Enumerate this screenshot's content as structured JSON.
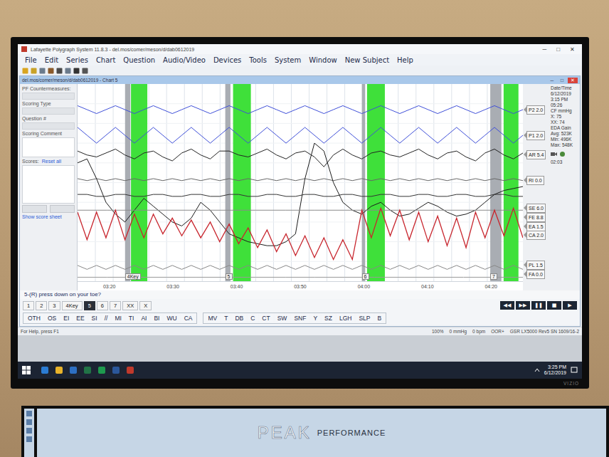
{
  "window": {
    "title": "Lafayette Polygraph System 11.8.3 - del.mos/comer/meson/d/dab0612019",
    "controls": [
      "─",
      "□",
      "✕"
    ]
  },
  "menu": [
    "File",
    "Edit",
    "Series",
    "Chart",
    "Question",
    "Audio/Video",
    "Devices",
    "Tools",
    "System",
    "Window",
    "New Subject",
    "Help"
  ],
  "inner_window": {
    "title": "del.mos/comer/meson/d/dab0612019 - Chart 5",
    "controls": [
      "─",
      "□",
      "✕"
    ]
  },
  "left_panel": {
    "countermeasures": "PF Countermeasures:",
    "scoring_type": "Scoring Type",
    "question": "Question #",
    "comment": "Scoring Comment",
    "scores": "Scores:",
    "reset": "Reset all",
    "show_sheet": "Show score sheet"
  },
  "info": [
    "Date/Time",
    "6/12/2019",
    "3:15 PM",
    "05:26",
    "CF mmHg",
    "X: 75",
    "XX: 74",
    "EDA Gain",
    "Avg: 523K",
    "Min: 496K",
    "Max: 548K"
  ],
  "timer": "02:03",
  "chart": {
    "channels": [
      {
        "name": "P2",
        "scale": "2.0",
        "color": "#3f4fd8",
        "values": [
          89,
          87,
          85,
          87,
          89,
          87,
          85,
          87,
          89,
          87,
          85,
          87,
          89,
          87,
          85,
          87,
          89,
          87,
          85,
          87,
          89,
          87,
          85,
          87,
          89,
          87,
          85,
          87,
          89,
          87,
          85,
          87,
          89,
          87,
          85,
          87,
          89,
          87,
          85,
          87,
          89,
          87,
          85,
          87,
          89,
          87,
          85,
          87
        ]
      },
      {
        "name": "P1",
        "scale": "2.0",
        "color": "#3f4fd8",
        "values": [
          78,
          74,
          70,
          74,
          78,
          74,
          70,
          74,
          78,
          74,
          70,
          74,
          78,
          74,
          70,
          74,
          78,
          74,
          70,
          74,
          78,
          74,
          70,
          74,
          78,
          74,
          70,
          74,
          78,
          74,
          70,
          74,
          78,
          74,
          70,
          74,
          78,
          74,
          70,
          74,
          78,
          74,
          70,
          74,
          78,
          74,
          70,
          74
        ]
      },
      {
        "name": "AR",
        "scale": "5.4",
        "color": "#222222",
        "values": [
          66,
          64,
          63,
          65,
          67,
          64,
          62,
          65,
          66,
          63,
          61,
          65,
          67,
          64,
          62,
          66,
          66,
          64,
          63,
          65,
          67,
          64,
          62,
          65,
          66,
          63,
          58,
          64,
          67,
          64,
          62,
          65,
          66,
          64,
          63,
          65,
          67,
          64,
          62,
          65,
          66,
          63,
          61,
          65,
          67,
          64,
          62,
          65
        ]
      },
      {
        "name": "RI",
        "scale": "0.0",
        "color": "#666666",
        "values": [
          52,
          51,
          52,
          51,
          52,
          51,
          52,
          51,
          52,
          51,
          52,
          51,
          52,
          51,
          52,
          51,
          52,
          51,
          52,
          51,
          52,
          51,
          52,
          51,
          52,
          51,
          52,
          51,
          52,
          51,
          52,
          51,
          52,
          51,
          52,
          51,
          52,
          51,
          52,
          51,
          52,
          51,
          52,
          51,
          52,
          51,
          52,
          51
        ]
      },
      {
        "name": "SE",
        "scale": "6.0",
        "color": "#1a1a1a",
        "values": [
          60,
          62,
          52,
          40,
          34,
          30,
          36,
          42,
          38,
          34,
          30,
          28,
          32,
          40,
          36,
          30,
          24,
          22,
          20,
          19,
          18,
          18,
          20,
          24,
          52,
          70,
          66,
          50,
          40,
          36,
          34,
          38,
          40,
          36,
          33,
          34,
          37,
          40,
          38,
          35,
          33,
          34,
          36,
          40,
          44,
          46,
          47,
          48
        ]
      },
      {
        "name": "FE",
        "scale": "8.8",
        "color": "#333333",
        "values": [
          44,
          44,
          43,
          43,
          44,
          44,
          43,
          43,
          44,
          44,
          43,
          43,
          44,
          44,
          43,
          43,
          44,
          44,
          43,
          43,
          44,
          44,
          43,
          43,
          44,
          44,
          43,
          43,
          44,
          44,
          43,
          43,
          44,
          44,
          43,
          43,
          44,
          44,
          43,
          43,
          44,
          44,
          43,
          43,
          44,
          44,
          43,
          43
        ]
      },
      {
        "name": "EA",
        "scale": "1.5",
        "color": "#8a8a8a",
        "values": [
          36,
          36,
          36,
          36,
          36,
          36,
          36,
          36,
          36,
          36,
          36,
          36,
          36,
          36,
          36,
          36
        ]
      },
      {
        "name": "CA",
        "scale": "2.0",
        "color": "#c8262e",
        "values": [
          35,
          21,
          35,
          22,
          36,
          21,
          34,
          22,
          34,
          24,
          32,
          23,
          31,
          22,
          30,
          20,
          29,
          19,
          27,
          17,
          26,
          15,
          24,
          13,
          23,
          12,
          22,
          11,
          21,
          11,
          36,
          22,
          37,
          23,
          36,
          21,
          35,
          20,
          33,
          18,
          32,
          17,
          35,
          22,
          36,
          23,
          37,
          22
        ]
      },
      {
        "name": "PL",
        "scale": "1.5",
        "color": "#888888",
        "values": [
          8,
          6,
          8,
          6,
          8,
          6,
          8,
          6,
          8,
          6,
          8,
          6,
          8,
          6,
          8,
          6,
          8,
          6,
          8,
          6,
          8,
          6,
          8,
          6,
          8,
          6,
          8,
          6,
          8,
          6,
          8,
          6,
          8,
          6,
          8,
          6,
          8,
          6,
          8,
          6,
          8,
          6,
          8,
          6,
          8,
          6,
          8,
          6
        ]
      },
      {
        "name": "FA",
        "scale": "0.0",
        "color": "#9a9a9a",
        "values": [
          2,
          2,
          2,
          2,
          2,
          2,
          2,
          2,
          2,
          2,
          2,
          2,
          2,
          2,
          2,
          2
        ]
      }
    ],
    "events": [
      {
        "label": "4Key",
        "mark": [
          12.8,
          14.2
        ],
        "answer": [
          14.4,
          18.8
        ]
      },
      {
        "label": "5",
        "mark": [
          39.8,
          41.2
        ],
        "answer": [
          41.9,
          46.7
        ]
      },
      {
        "label": "6",
        "mark": [
          76.6,
          77.5
        ],
        "answer": [
          78.0,
          82.8
        ]
      },
      {
        "label": "7",
        "mark": [
          111.2,
          114.2
        ],
        "answer": [
          114.8,
          118.8
        ]
      }
    ],
    "ticks": [
      "03:20",
      "03:30",
      "03:40",
      "03:50",
      "04:00",
      "04:10",
      "04:20"
    ]
  },
  "question": "5-(R) press down on your toe?",
  "series_tabs": [
    {
      "label": "1",
      "selected": false
    },
    {
      "label": "2",
      "selected": false
    },
    {
      "label": "3",
      "selected": false
    },
    {
      "label": "4Key",
      "selected": false
    },
    {
      "label": "5",
      "selected": true
    },
    {
      "label": "6",
      "selected": false
    },
    {
      "label": "7",
      "selected": false
    },
    {
      "label": "XX",
      "selected": false
    },
    {
      "label": "X",
      "selected": false
    }
  ],
  "playback": [
    "◀◀",
    "▶▶",
    "❚❚",
    "■",
    "▶"
  ],
  "score_buttons": [
    [
      "OTH",
      "OS",
      "EI",
      "EE",
      "SI",
      "//",
      "MI",
      "TI",
      "AI",
      "BI",
      "WU",
      "CA"
    ],
    [
      "MV",
      "T",
      "DB",
      "C",
      "CT",
      "SW",
      "SNF",
      "Y",
      "SZ",
      "LGH",
      "SLP",
      "B"
    ]
  ],
  "status_bar": {
    "help": "For Help, press F1",
    "items": [
      "100%",
      "0 mmHg",
      "0 bpm",
      "OOR+",
      "GSR LX5000 Rev5 SN 1609/16-2"
    ]
  },
  "taskbar": {
    "apps": [
      {
        "color": "#2b7cd3"
      },
      {
        "color": "#e8b32a"
      },
      {
        "color": "#2d6fc2"
      },
      {
        "color": "#217346"
      },
      {
        "color": "#1e9a4e"
      },
      {
        "color": "#2b579a"
      },
      {
        "color": "#c0392b"
      }
    ],
    "time": "3:25 PM",
    "date": "6/12/2019"
  },
  "tv": {
    "brand": "VIZIO"
  },
  "second_monitor": {
    "logo": "PEAK",
    "subtitle": "PERFORMANCE"
  }
}
